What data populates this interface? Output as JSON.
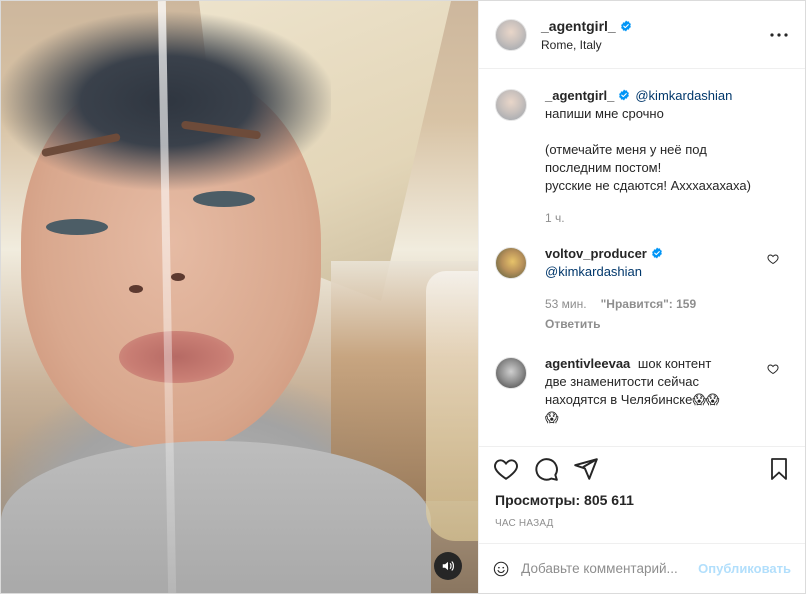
{
  "post": {
    "author": "_agentgirl_",
    "location": "Rome, Italy",
    "caption": {
      "username": "_agentgirl_",
      "mention": "@kimkardashian",
      "text": "напиши мне срочно\n\n(отмечайте меня у неё под\nпоследним постом!\nрусские не сдаются! Ахххахахаха)",
      "time": "1 ч."
    },
    "comments": [
      {
        "username": "voltov_producer",
        "mention": "@kimkardashian",
        "time": "53 мин.",
        "likes": "\"Нравится\": 159",
        "reply": "Ответить"
      },
      {
        "username": "agentivleevaa",
        "text": "шок контент\nдве знаменитости сейчас\nнаходятся в Челябинске😱😱\n😱"
      }
    ],
    "views_label": "Просмотры: 805 611",
    "time_ago": "ЧАС НАЗАД",
    "comment_placeholder": "Добавьте комментарий...",
    "post_button": "Опубликовать"
  },
  "colors": {
    "verified": "#0095f6",
    "link": "#00376b",
    "post_button": "#b2dffc"
  },
  "icons": [
    "more-icon",
    "heart-icon",
    "comment-icon",
    "share-icon",
    "bookmark-icon",
    "emoji-icon",
    "sound-icon",
    "verified-icon"
  ]
}
